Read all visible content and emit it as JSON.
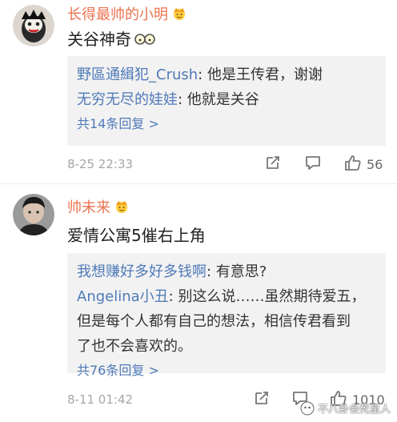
{
  "comments": [
    {
      "username": "长得最帅的小明",
      "text": "关谷神奇",
      "replies": [
        {
          "name": "野區通緝犯_Crush",
          "text": ": 他是王传君，谢谢"
        },
        {
          "name": "无穷无尽的娃娃",
          "text": ": 他就是关谷"
        }
      ],
      "more": "共14条回复 >",
      "time": "8-25 22:33",
      "likes": "56",
      "badge_icon": "crown-emoji-icon",
      "text_icon": "nerd-glasses-emoji-icon"
    },
    {
      "username": "帅未来",
      "text": "爱情公寓5催右上角",
      "replies": [
        {
          "name": "我想赚好多好多钱啊",
          "text": ": 有意思?"
        },
        {
          "name": "Angelina小丑",
          "text": ": 别这么说……虽然期待爱五，"
        },
        {
          "name": "",
          "text": "但是每个人都有自己的想法，相信传君看到"
        },
        {
          "name": "",
          "text": "了也不会喜欢的。"
        }
      ],
      "more": "共76条回复 >",
      "time": "8-11 01:42",
      "likes": "1010",
      "badge_icon": "crown-emoji-icon"
    }
  ],
  "watermark": "不八卦会死星人",
  "colors": {
    "username": "#eb7350",
    "link": "#4f7ab8",
    "reply_bg": "#f2f2f2",
    "meta": "#a6a6a6"
  }
}
